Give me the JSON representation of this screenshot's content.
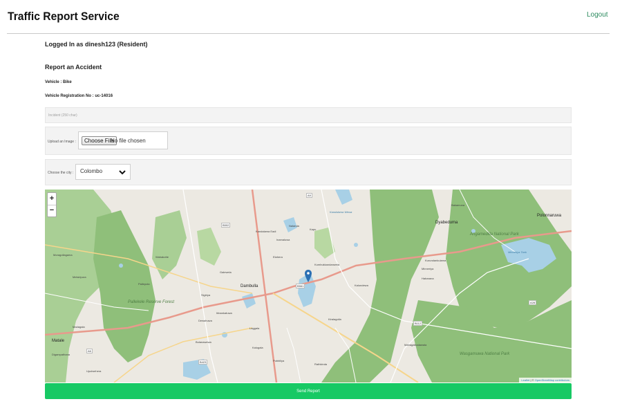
{
  "header": {
    "app_title": "Traffic Report Service",
    "logout_label": "Logout"
  },
  "user": {
    "logged_in_text": "Logged In as dinesh123 (Resident)"
  },
  "form": {
    "section_title": "Report an Accident",
    "vehicle_text": "Vehicle : Bike",
    "registration_text": "Vehicle Registration No : uc-14016",
    "incident_placeholder": "Incident (250 char)",
    "upload_label": "Upload an Image :",
    "file_button_label": "Choose File",
    "file_status": "No file chosen",
    "city_label": "Choose the city :",
    "city_selected": "Colombo",
    "submit_label": "Send Report"
  },
  "map": {
    "zoom_in_label": "+",
    "zoom_out_label": "−",
    "attribution_leaflet": "Leaflet",
    "attribution_sep": " | © ",
    "attribution_osm": "OpenStreetMap contributors",
    "labels": {
      "dambulla": "Dambulla",
      "matale": "Matale",
      "digampathana": "Digampathana",
      "polonnaruwa": "Polonnaruwa",
      "dyabeduma": "Dyabeduma",
      "elahera": "Elahera",
      "nalanda": "Nalanda",
      "kandalama": "Kandalama Eadi",
      "galewela": "Galewela",
      "pallepola": "Pallepola",
      "kapu": "Kapu",
      "sigiriya": "Sigiriya",
      "moragollagama": "Moragollagama",
      "bakamuna": "Bakamuna",
      "minneriya": "Minneriya",
      "habarana": "Habarana",
      "dewahuwa": "Dewahuwa",
      "kumbukkandanwela": "Kumbukkandanwela",
      "ibbankatuwa": "Ibbankatuwa",
      "inamaluwa": "Inamaluwa",
      "kalundewa": "Kalundewa",
      "melsiripura": "Melsiripura",
      "wahakotte": "Wahakotte",
      "laggala": "Laggala",
      "kalugala": "Kalugala",
      "bulanawewa": "Bulanawewa",
      "kiralagolla": "Kiralagolla",
      "kurundankulama": "Kurundankulama",
      "pubbiliya": "Pubbiliya",
      "mahagalkadawala": "Mahagalkadawala",
      "madagala": "Madagala",
      "rathkinda": "Rathkinda",
      "upulwehera": "Upulwehera",
      "lake_1": "Minneriya Tank",
      "lake_2": "Kandalama Wewa",
      "park_1": "Angamedilla National Park",
      "park_2": "Wasgamuwa National Park",
      "park_3": "Pallekele Reserve Forest",
      "road_a9": "A9",
      "road_b502": "B502",
      "road_a6": "A6",
      "road_b423": "B423",
      "road_b112": "B112",
      "road_b561": "B561",
      "road_a28": "A28"
    }
  },
  "colors": {
    "accent_green": "#17c964",
    "logout_color": "#2b8a5e",
    "forest": "#8fbf7a",
    "water": "#a8d0e6",
    "land": "#ece9e2",
    "road_major": "#e89a8c",
    "road_minor": "#f6d58b",
    "marker": "#2a6fb3"
  },
  "icons": {
    "city_dropdown": "chevron-down-icon",
    "map_marker": "map-pin-icon"
  }
}
